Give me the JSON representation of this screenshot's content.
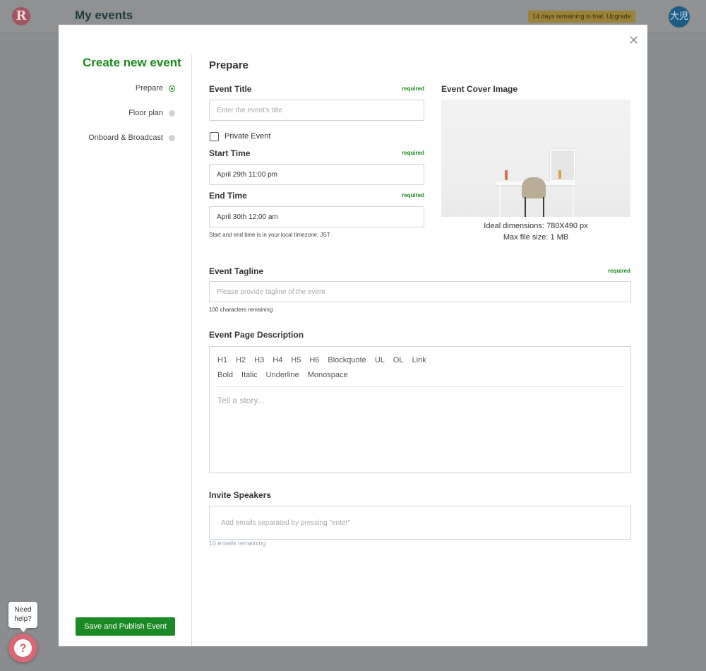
{
  "header": {
    "logo_letter": "R",
    "title": "My events",
    "trial_text": "14 days remaining in trial.",
    "upgrade_label": "Upgrade",
    "avatar_text": "大児"
  },
  "sidebar": {
    "title": "Create new event",
    "steps": [
      {
        "label": "Prepare",
        "status": "active"
      },
      {
        "label": "Floor plan",
        "status": "inactive"
      },
      {
        "label": "Onboard & Broadcast",
        "status": "inactive"
      }
    ],
    "save_label": "Save and Publish Event"
  },
  "form": {
    "section_title": "Prepare",
    "required_text": "required",
    "event_title": {
      "label": "Event Title",
      "placeholder": "Enter the event's title",
      "value": ""
    },
    "private_event": {
      "label": "Private Event",
      "checked": false
    },
    "start_time": {
      "label": "Start Time",
      "value": "April 29th 11:00 pm"
    },
    "end_time": {
      "label": "End Time",
      "value": "April 30th 12:00 am"
    },
    "timezone_hint": "Start and end time is in your local timezone: JST",
    "cover": {
      "label": "Event Cover Image",
      "dimensions": "Ideal dimensions: 780X490 px",
      "max_size": "Max file size: 1 MB"
    },
    "tagline": {
      "label": "Event Tagline",
      "placeholder": "Please provide tagline of the event",
      "remaining": "100 characters remaining"
    },
    "description": {
      "label": "Event Page Description",
      "toolbar_row1": [
        "H1",
        "H2",
        "H3",
        "H4",
        "H5",
        "H6",
        "Blockquote",
        "UL",
        "OL",
        "Link"
      ],
      "toolbar_row2": [
        "Bold",
        "Italic",
        "Underline",
        "Monospace"
      ],
      "placeholder": "Tell a story..."
    },
    "speakers": {
      "label": "Invite Speakers",
      "placeholder": "Add emails separated by pressing \"enter\"",
      "remaining": "10 emails remaining"
    }
  },
  "help": {
    "bubble_line1": "Need",
    "bubble_line2": "help?",
    "icon_glyph": "?"
  },
  "close_glyph": "✕",
  "colors": {
    "accent_green": "#1a8a1a",
    "button_green": "#1b8a24",
    "help_pink": "#d76975"
  }
}
